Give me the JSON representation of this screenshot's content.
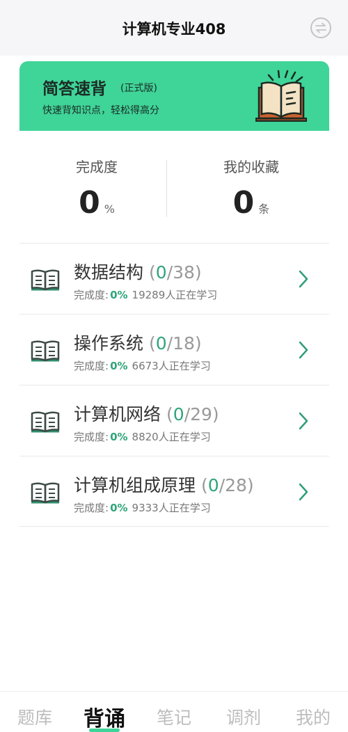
{
  "header": {
    "title": "计算机专业408"
  },
  "banner": {
    "title": "简答速背",
    "tag": "(正式版)",
    "subtitle": "快速背知识点，轻松得高分"
  },
  "stats": {
    "completion": {
      "label": "完成度",
      "value": "0",
      "unit": "%"
    },
    "favorites": {
      "label": "我的收藏",
      "value": "0",
      "unit": "条"
    }
  },
  "subjects": [
    {
      "name": "数据结构",
      "done": "0",
      "total": "/38)",
      "open": "(",
      "progress_label": "完成度:",
      "progress": "0%",
      "learners": "19289人正在学习"
    },
    {
      "name": "操作系统",
      "done": "0",
      "total": "/18)",
      "open": "(",
      "progress_label": "完成度:",
      "progress": "0%",
      "learners": "6673人正在学习"
    },
    {
      "name": "计算机网络",
      "done": "0",
      "total": "/29)",
      "open": "(",
      "progress_label": "完成度:",
      "progress": "0%",
      "learners": "8820人正在学习"
    },
    {
      "name": "计算机组成原理",
      "done": "0",
      "total": "/28)",
      "open": "(",
      "progress_label": "完成度:",
      "progress": "0%",
      "learners": "9333人正在学习"
    }
  ],
  "tabs": [
    {
      "label": "题库"
    },
    {
      "label": "背诵"
    },
    {
      "label": "笔记"
    },
    {
      "label": "调剂"
    },
    {
      "label": "我的"
    }
  ],
  "colors": {
    "accent": "#3fd498",
    "accent_text": "#2fa57a"
  }
}
